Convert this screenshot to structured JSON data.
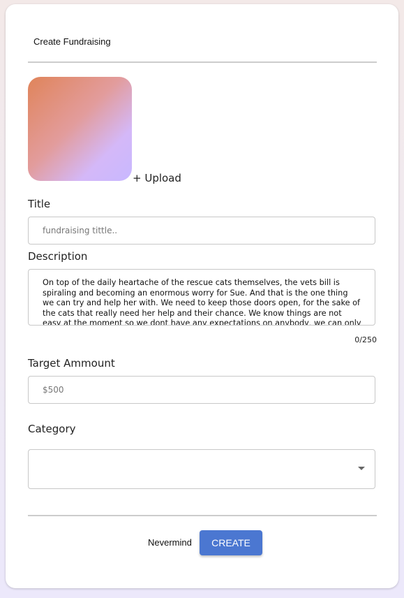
{
  "header": {
    "title": "Create Fundraising"
  },
  "image": {
    "upload_label": "+ Upload"
  },
  "form": {
    "title_label": "Title",
    "title_placeholder": "fundraising tittle..",
    "description_label": "Description",
    "description_value": "On top of the daily heartache of the rescue cats themselves, the vets bill is spiraling and becoming an enormous worry for Sue. And that is the one thing we can try and help her with. We need to keep those doors open, for the sake of the cats that really need her help and their chance. We know things are not easy at the moment so we dont have any expectations on anybody, we can only hope that",
    "description_counter": "0/250",
    "target_label": "Target Ammount",
    "target_placeholder": "$500",
    "category_label": "Category",
    "category_value": ""
  },
  "actions": {
    "cancel_label": "Nevermind",
    "create_label": "CREATE"
  },
  "colors": {
    "accent": "#4b77d1"
  }
}
